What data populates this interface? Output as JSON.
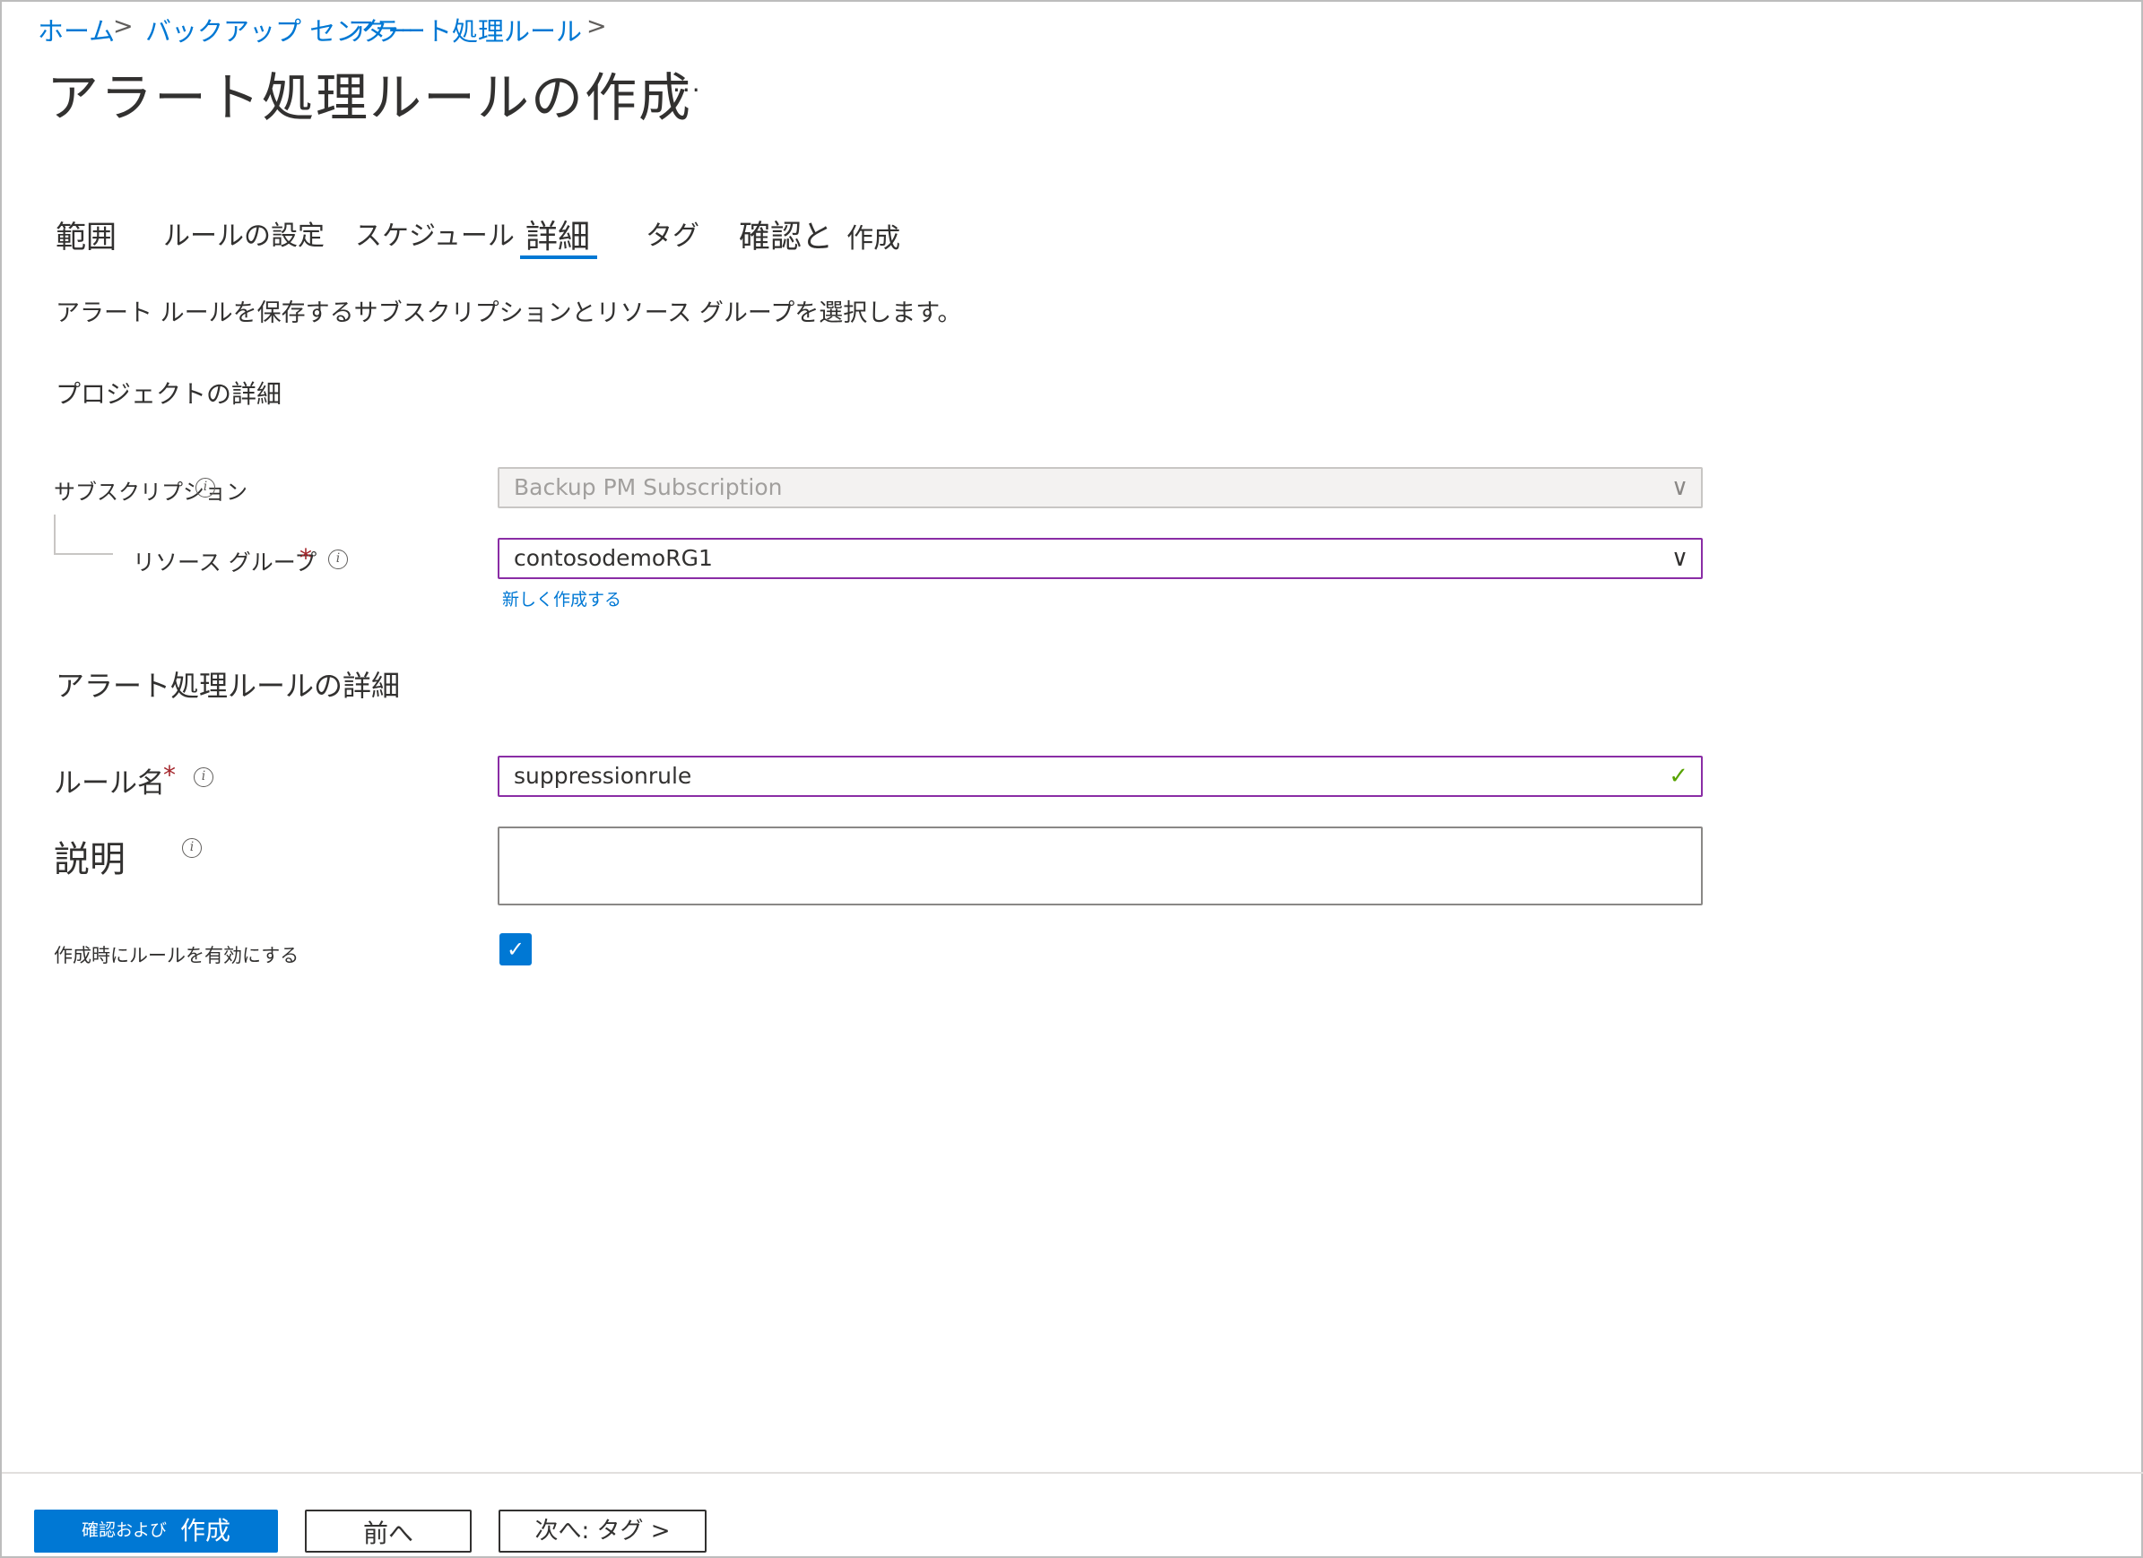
{
  "breadcrumb": {
    "home": "ホーム",
    "sep1": ">",
    "backup_center": "バックアップ センター",
    "alert_rules": "アラート処理ルール",
    "sep2": ">"
  },
  "page": {
    "title": "アラート処理ルールの作成",
    "more": "..."
  },
  "tabs": [
    {
      "label": "範囲"
    },
    {
      "label": "ルールの設定"
    },
    {
      "label": "スケジュール"
    },
    {
      "label": "詳細",
      "selected": true
    },
    {
      "label": "タグ"
    },
    {
      "label_part1": "確認と",
      "label_part2": "作成"
    }
  ],
  "description": "アラート ルールを保存するサブスクリプションとリソース グループを選択します。",
  "project": {
    "heading": "プロジェクトの詳細",
    "subscription_label": "サブスクリプション",
    "subscription_value": "Backup PM Subscription",
    "resource_group_label": "リソース グループ",
    "resource_group_value": "contosodemoRG1",
    "create_new": "新しく作成する"
  },
  "rule_details": {
    "heading": "アラート処理ルールの詳細",
    "rule_name_label": "ルール名",
    "rule_name_value": "suppressionrule",
    "description_label": "説明",
    "description_value": "",
    "enable_label": "作成時にルールを有効にする",
    "enable_checked": true
  },
  "required_mark": "*",
  "info_glyph": "i",
  "icons": {
    "chevron": "chevron-down-icon",
    "check": "checkmark-icon"
  },
  "footer": {
    "review_small": "確認および",
    "review_big": "作成",
    "prev": "前へ",
    "next": "次へ: タグ >"
  },
  "colors": {
    "accent": "#0078d4",
    "focus_border": "#8a2da5",
    "valid": "#57a300",
    "required": "#a4262c"
  }
}
